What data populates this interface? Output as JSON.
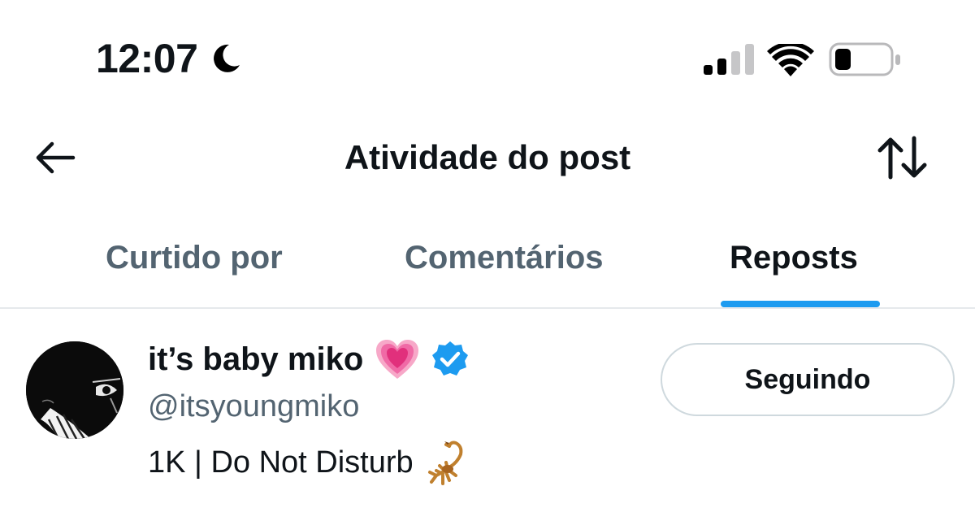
{
  "status_bar": {
    "time": "12:07",
    "moon_icon": "moon-icon",
    "signal_icon": "cellular-signal-icon",
    "wifi_icon": "wifi-icon",
    "battery_icon": "battery-icon",
    "battery_level": 0.3
  },
  "header": {
    "title": "Atividade do post",
    "back_icon": "arrow-left-icon",
    "sort_icon": "sort-arrows-icon"
  },
  "tabs": [
    {
      "label": "Curtido por",
      "active": false
    },
    {
      "label": "Comentários",
      "active": false
    },
    {
      "label": "Reposts",
      "active": true
    }
  ],
  "accent_color": "#1d9bf0",
  "user": {
    "display_name": "it’s baby miko",
    "name_emoji": "growing-heart-icon",
    "verified_icon": "verified-badge-icon",
    "handle": "@itsyoungmiko",
    "bio": "1K | Do Not Disturb",
    "bio_emoji": "scorpion-icon",
    "follow_label": "Seguindo"
  }
}
